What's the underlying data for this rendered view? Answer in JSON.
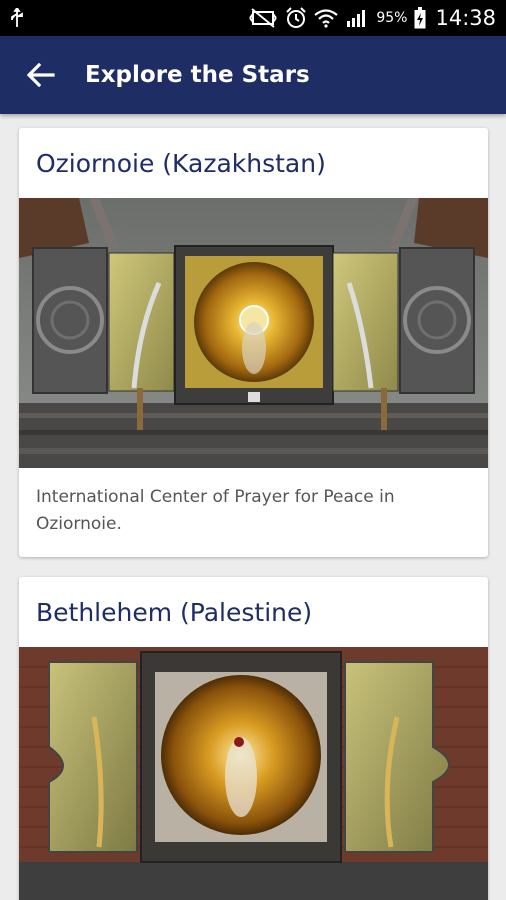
{
  "status_bar": {
    "icons": [
      "usb-icon",
      "mute-icon",
      "alarm-icon",
      "wifi-icon",
      "signal-icon",
      "battery-icon"
    ],
    "battery": "95%",
    "time": "14:38"
  },
  "app_bar": {
    "back_icon": "arrow-back-icon",
    "title": "Explore the Stars",
    "color": "#1e2d63"
  },
  "cards": [
    {
      "title": "Oziornoie (Kazakhstan)",
      "description": "International Center of Prayer for Peace in Oziornoie."
    },
    {
      "title": "Bethlehem (Palestine)",
      "description": ""
    }
  ]
}
